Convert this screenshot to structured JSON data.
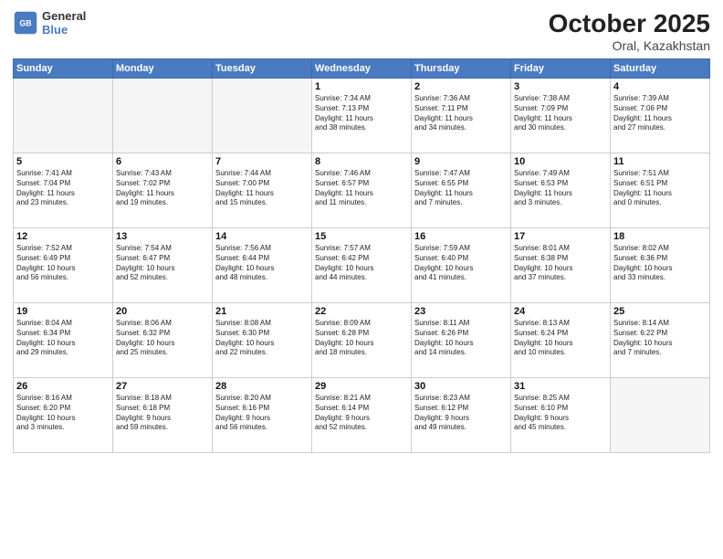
{
  "header": {
    "logo_line1": "General",
    "logo_line2": "Blue",
    "month": "October 2025",
    "location": "Oral, Kazakhstan"
  },
  "days_of_week": [
    "Sunday",
    "Monday",
    "Tuesday",
    "Wednesday",
    "Thursday",
    "Friday",
    "Saturday"
  ],
  "weeks": [
    [
      {
        "day": "",
        "info": ""
      },
      {
        "day": "",
        "info": ""
      },
      {
        "day": "",
        "info": ""
      },
      {
        "day": "1",
        "info": "Sunrise: 7:34 AM\nSunset: 7:13 PM\nDaylight: 11 hours\nand 38 minutes."
      },
      {
        "day": "2",
        "info": "Sunrise: 7:36 AM\nSunset: 7:11 PM\nDaylight: 11 hours\nand 34 minutes."
      },
      {
        "day": "3",
        "info": "Sunrise: 7:38 AM\nSunset: 7:09 PM\nDaylight: 11 hours\nand 30 minutes."
      },
      {
        "day": "4",
        "info": "Sunrise: 7:39 AM\nSunset: 7:06 PM\nDaylight: 11 hours\nand 27 minutes."
      }
    ],
    [
      {
        "day": "5",
        "info": "Sunrise: 7:41 AM\nSunset: 7:04 PM\nDaylight: 11 hours\nand 23 minutes."
      },
      {
        "day": "6",
        "info": "Sunrise: 7:43 AM\nSunset: 7:02 PM\nDaylight: 11 hours\nand 19 minutes."
      },
      {
        "day": "7",
        "info": "Sunrise: 7:44 AM\nSunset: 7:00 PM\nDaylight: 11 hours\nand 15 minutes."
      },
      {
        "day": "8",
        "info": "Sunrise: 7:46 AM\nSunset: 6:57 PM\nDaylight: 11 hours\nand 11 minutes."
      },
      {
        "day": "9",
        "info": "Sunrise: 7:47 AM\nSunset: 6:55 PM\nDaylight: 11 hours\nand 7 minutes."
      },
      {
        "day": "10",
        "info": "Sunrise: 7:49 AM\nSunset: 6:53 PM\nDaylight: 11 hours\nand 3 minutes."
      },
      {
        "day": "11",
        "info": "Sunrise: 7:51 AM\nSunset: 6:51 PM\nDaylight: 11 hours\nand 0 minutes."
      }
    ],
    [
      {
        "day": "12",
        "info": "Sunrise: 7:52 AM\nSunset: 6:49 PM\nDaylight: 10 hours\nand 56 minutes."
      },
      {
        "day": "13",
        "info": "Sunrise: 7:54 AM\nSunset: 6:47 PM\nDaylight: 10 hours\nand 52 minutes."
      },
      {
        "day": "14",
        "info": "Sunrise: 7:56 AM\nSunset: 6:44 PM\nDaylight: 10 hours\nand 48 minutes."
      },
      {
        "day": "15",
        "info": "Sunrise: 7:57 AM\nSunset: 6:42 PM\nDaylight: 10 hours\nand 44 minutes."
      },
      {
        "day": "16",
        "info": "Sunrise: 7:59 AM\nSunset: 6:40 PM\nDaylight: 10 hours\nand 41 minutes."
      },
      {
        "day": "17",
        "info": "Sunrise: 8:01 AM\nSunset: 6:38 PM\nDaylight: 10 hours\nand 37 minutes."
      },
      {
        "day": "18",
        "info": "Sunrise: 8:02 AM\nSunset: 6:36 PM\nDaylight: 10 hours\nand 33 minutes."
      }
    ],
    [
      {
        "day": "19",
        "info": "Sunrise: 8:04 AM\nSunset: 6:34 PM\nDaylight: 10 hours\nand 29 minutes."
      },
      {
        "day": "20",
        "info": "Sunrise: 8:06 AM\nSunset: 6:32 PM\nDaylight: 10 hours\nand 25 minutes."
      },
      {
        "day": "21",
        "info": "Sunrise: 8:08 AM\nSunset: 6:30 PM\nDaylight: 10 hours\nand 22 minutes."
      },
      {
        "day": "22",
        "info": "Sunrise: 8:09 AM\nSunset: 6:28 PM\nDaylight: 10 hours\nand 18 minutes."
      },
      {
        "day": "23",
        "info": "Sunrise: 8:11 AM\nSunset: 6:26 PM\nDaylight: 10 hours\nand 14 minutes."
      },
      {
        "day": "24",
        "info": "Sunrise: 8:13 AM\nSunset: 6:24 PM\nDaylight: 10 hours\nand 10 minutes."
      },
      {
        "day": "25",
        "info": "Sunrise: 8:14 AM\nSunset: 6:22 PM\nDaylight: 10 hours\nand 7 minutes."
      }
    ],
    [
      {
        "day": "26",
        "info": "Sunrise: 8:16 AM\nSunset: 6:20 PM\nDaylight: 10 hours\nand 3 minutes."
      },
      {
        "day": "27",
        "info": "Sunrise: 8:18 AM\nSunset: 6:18 PM\nDaylight: 9 hours\nand 59 minutes."
      },
      {
        "day": "28",
        "info": "Sunrise: 8:20 AM\nSunset: 6:16 PM\nDaylight: 9 hours\nand 56 minutes."
      },
      {
        "day": "29",
        "info": "Sunrise: 8:21 AM\nSunset: 6:14 PM\nDaylight: 9 hours\nand 52 minutes."
      },
      {
        "day": "30",
        "info": "Sunrise: 8:23 AM\nSunset: 6:12 PM\nDaylight: 9 hours\nand 49 minutes."
      },
      {
        "day": "31",
        "info": "Sunrise: 8:25 AM\nSunset: 6:10 PM\nDaylight: 9 hours\nand 45 minutes."
      },
      {
        "day": "",
        "info": ""
      }
    ]
  ]
}
